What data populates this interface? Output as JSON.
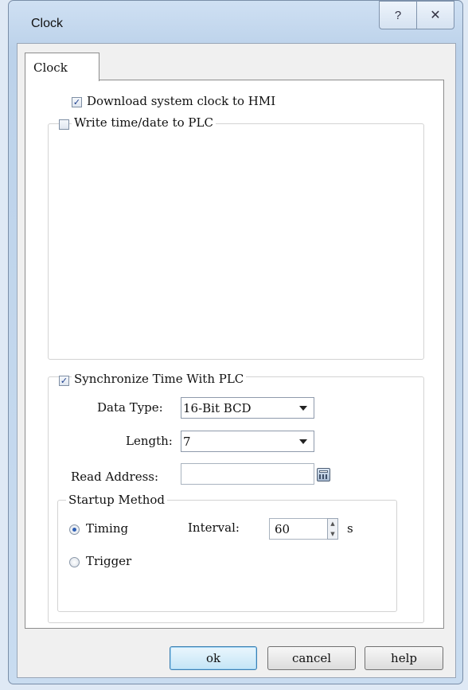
{
  "window": {
    "title": "Clock",
    "help_glyph": "?",
    "close_glyph": "✕"
  },
  "tab": {
    "label": "Clock"
  },
  "download_clock": {
    "label": "Download system clock to HMI",
    "checked": true
  },
  "write_time": {
    "label": "Write time/date to PLC",
    "checked": false
  },
  "sync": {
    "label": "Synchronize Time With PLC",
    "checked": true,
    "data_type_label": "Data Type:",
    "data_type_value": "16-Bit BCD",
    "length_label": "Length:",
    "length_value": "7",
    "read_address_label": "Read Address:",
    "read_address_value": ""
  },
  "startup": {
    "label": "Startup Method",
    "timing_label": "Timing",
    "timing_selected": true,
    "trigger_label": "Trigger",
    "trigger_selected": false,
    "interval_label": "Interval:",
    "interval_value": "60",
    "interval_unit": "s"
  },
  "buttons": {
    "ok": "ok",
    "cancel": "cancel",
    "help": "help"
  }
}
